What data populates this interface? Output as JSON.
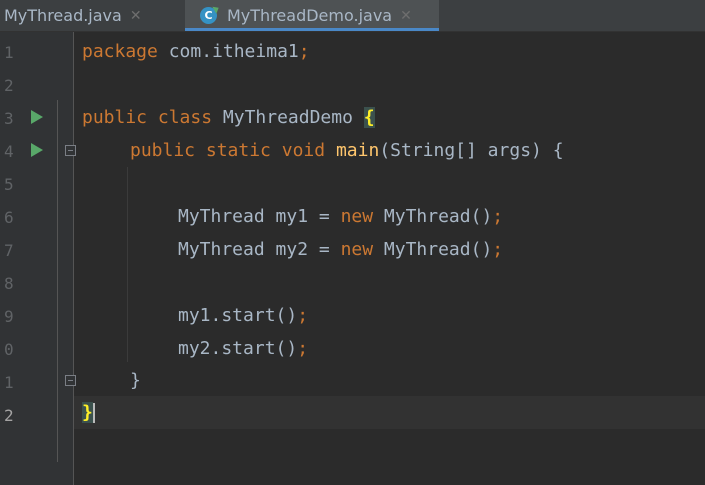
{
  "tabs": [
    {
      "label": "MyThread.java",
      "close": "✕",
      "active": false
    },
    {
      "label": "MyThreadDemo.java",
      "close": "✕",
      "active": true,
      "icon": "C"
    }
  ],
  "gutter": {
    "line_numbers": [
      "1",
      "2",
      "3",
      "4",
      "5",
      "6",
      "7",
      "8",
      "9",
      "0",
      "1",
      "2"
    ]
  },
  "code": {
    "l1_kw": "package",
    "l1_rest": " com.itheima1",
    "l1_semi": ";",
    "l3_kw1": "public",
    "l3_kw2": "class",
    "l3_name": " MyThreadDemo ",
    "l3_brace": "{",
    "l4_kw1": "public",
    "l4_kw2": "static",
    "l4_kw3": "void",
    "l4_fn": "main",
    "l4_rest": "(String[] args) {",
    "l6_a": "MyThread my1 = ",
    "l6_kw": "new",
    "l6_b": " MyThread()",
    "l6_semi": ";",
    "l7_a": "MyThread my2 = ",
    "l7_kw": "new",
    "l7_b": " MyThread()",
    "l7_semi": ";",
    "l9_a": "my1.start()",
    "l9_semi": ";",
    "l10_a": "my2.start()",
    "l10_semi": ";",
    "l11_a": "}",
    "l12_a": "}"
  },
  "colors": {
    "background": "#2b2b2b",
    "keyword": "#cc7832",
    "function": "#ffc66d",
    "text": "#a9b7c6",
    "run_icon": "#59a869",
    "tab_accent": "#4a88c7"
  }
}
